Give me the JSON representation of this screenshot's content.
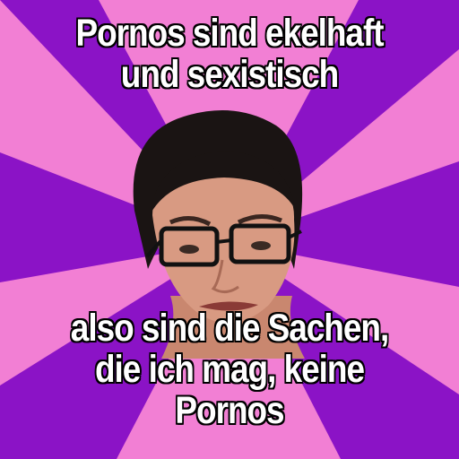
{
  "meme": {
    "top_text": [
      "Pornos sind ekelhaft",
      "und sexistisch"
    ],
    "bottom_text": [
      "also sind die Sachen,",
      "die ich mag, keine",
      "Pornos"
    ]
  },
  "colors": {
    "ray_pink": "#f27fd4",
    "ray_purple": "#8b13c6",
    "caption_text": "#ffffff",
    "caption_outline": "#000000"
  },
  "icons": [
    "portrait-of-woman-with-glasses"
  ]
}
